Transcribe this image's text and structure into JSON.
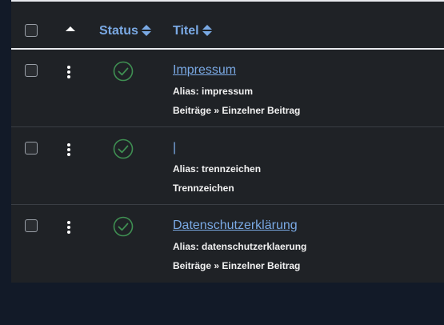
{
  "header": {
    "status_label": "Status",
    "title_label": "Titel"
  },
  "colors": {
    "link": "#7aa9e4",
    "status_ok": "#3f8f52",
    "row_bg": "#1f2226",
    "page_bg": "#121a28"
  },
  "rows": [
    {
      "status_icon": "check-circle-icon",
      "title": "Impressum",
      "alias": "Alias: impressum",
      "category": "Beiträge » Einzelner Beitrag"
    },
    {
      "status_icon": "check-circle-icon",
      "title": "|",
      "alias": "Alias: trennzeichen",
      "category": "Trennzeichen"
    },
    {
      "status_icon": "check-circle-icon",
      "title": "Datenschutzerklärung",
      "alias": "Alias: datenschutzerklaerung",
      "category": "Beiträge » Einzelner Beitrag"
    }
  ]
}
